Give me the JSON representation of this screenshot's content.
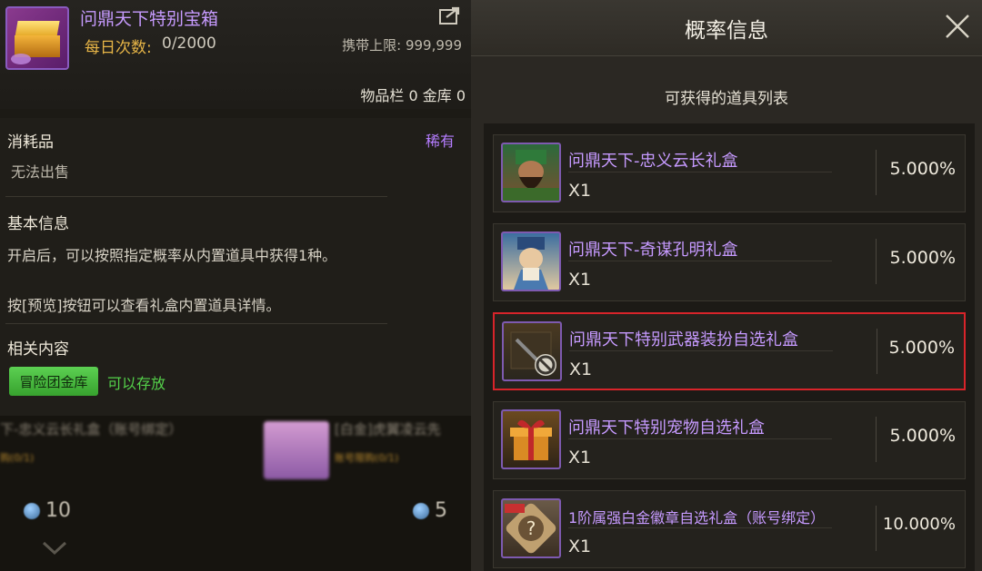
{
  "item": {
    "name": "问鼎天下特别宝箱",
    "daily_label": "每日次数:",
    "daily_value": "0/2000",
    "carry_limit": "携带上限: 999,999",
    "storage": "物品栏 0 金库 0"
  },
  "details": {
    "type": "消耗品",
    "rarity": "稀有",
    "trade": "无法出售",
    "basic_title": "基本信息",
    "basic_line1": "开启后，可以按照指定概率从内置道具中获得1种。",
    "basic_line2": "按[预览]按钮可以查看礼盒内置道具详情。",
    "related_title": "相关内容",
    "related_tag": "冒险团金库",
    "related_text": "可以存放"
  },
  "background": {
    "blur_text1": "下-忠义云长礼盒（账号绑定）",
    "blur_text2": "[白金]虎翼凌云先",
    "blur_sub1": "购(0/1)",
    "blur_sub2": "账号限购(0/1)",
    "coin1": "10",
    "coin2": "5"
  },
  "panel": {
    "title": "概率信息",
    "list_title": "可获得的道具列表",
    "close_icon": "close-icon"
  },
  "rewards": [
    {
      "name": "问鼎天下-忠义云长礼盒",
      "qty": "X1",
      "prob": "5.000%",
      "icon": "guan-yu-portrait-icon",
      "selected": false
    },
    {
      "name": "问鼎天下-奇谋孔明礼盒",
      "qty": "X1",
      "prob": "5.000%",
      "icon": "zhuge-liang-portrait-icon",
      "selected": false
    },
    {
      "name": "问鼎天下特别武器装扮自选礼盒",
      "qty": "X1",
      "prob": "5.000%",
      "icon": "weapon-box-disabled-icon",
      "selected": true
    },
    {
      "name": "问鼎天下特别宠物自选礼盒",
      "qty": "X1",
      "prob": "5.000%",
      "icon": "pet-gift-box-icon",
      "selected": false
    },
    {
      "name": "1阶属强白金徽章自选礼盒（账号绑定）",
      "qty": "X1",
      "prob": "10.000%",
      "icon": "platinum-badge-box-icon",
      "selected": false
    }
  ],
  "colors": {
    "item_name": "#c79bff",
    "daily_label": "#e7b547",
    "rarity": "#b57dff",
    "tag_green": "#4cc744",
    "selected_border": "#d8242a"
  }
}
